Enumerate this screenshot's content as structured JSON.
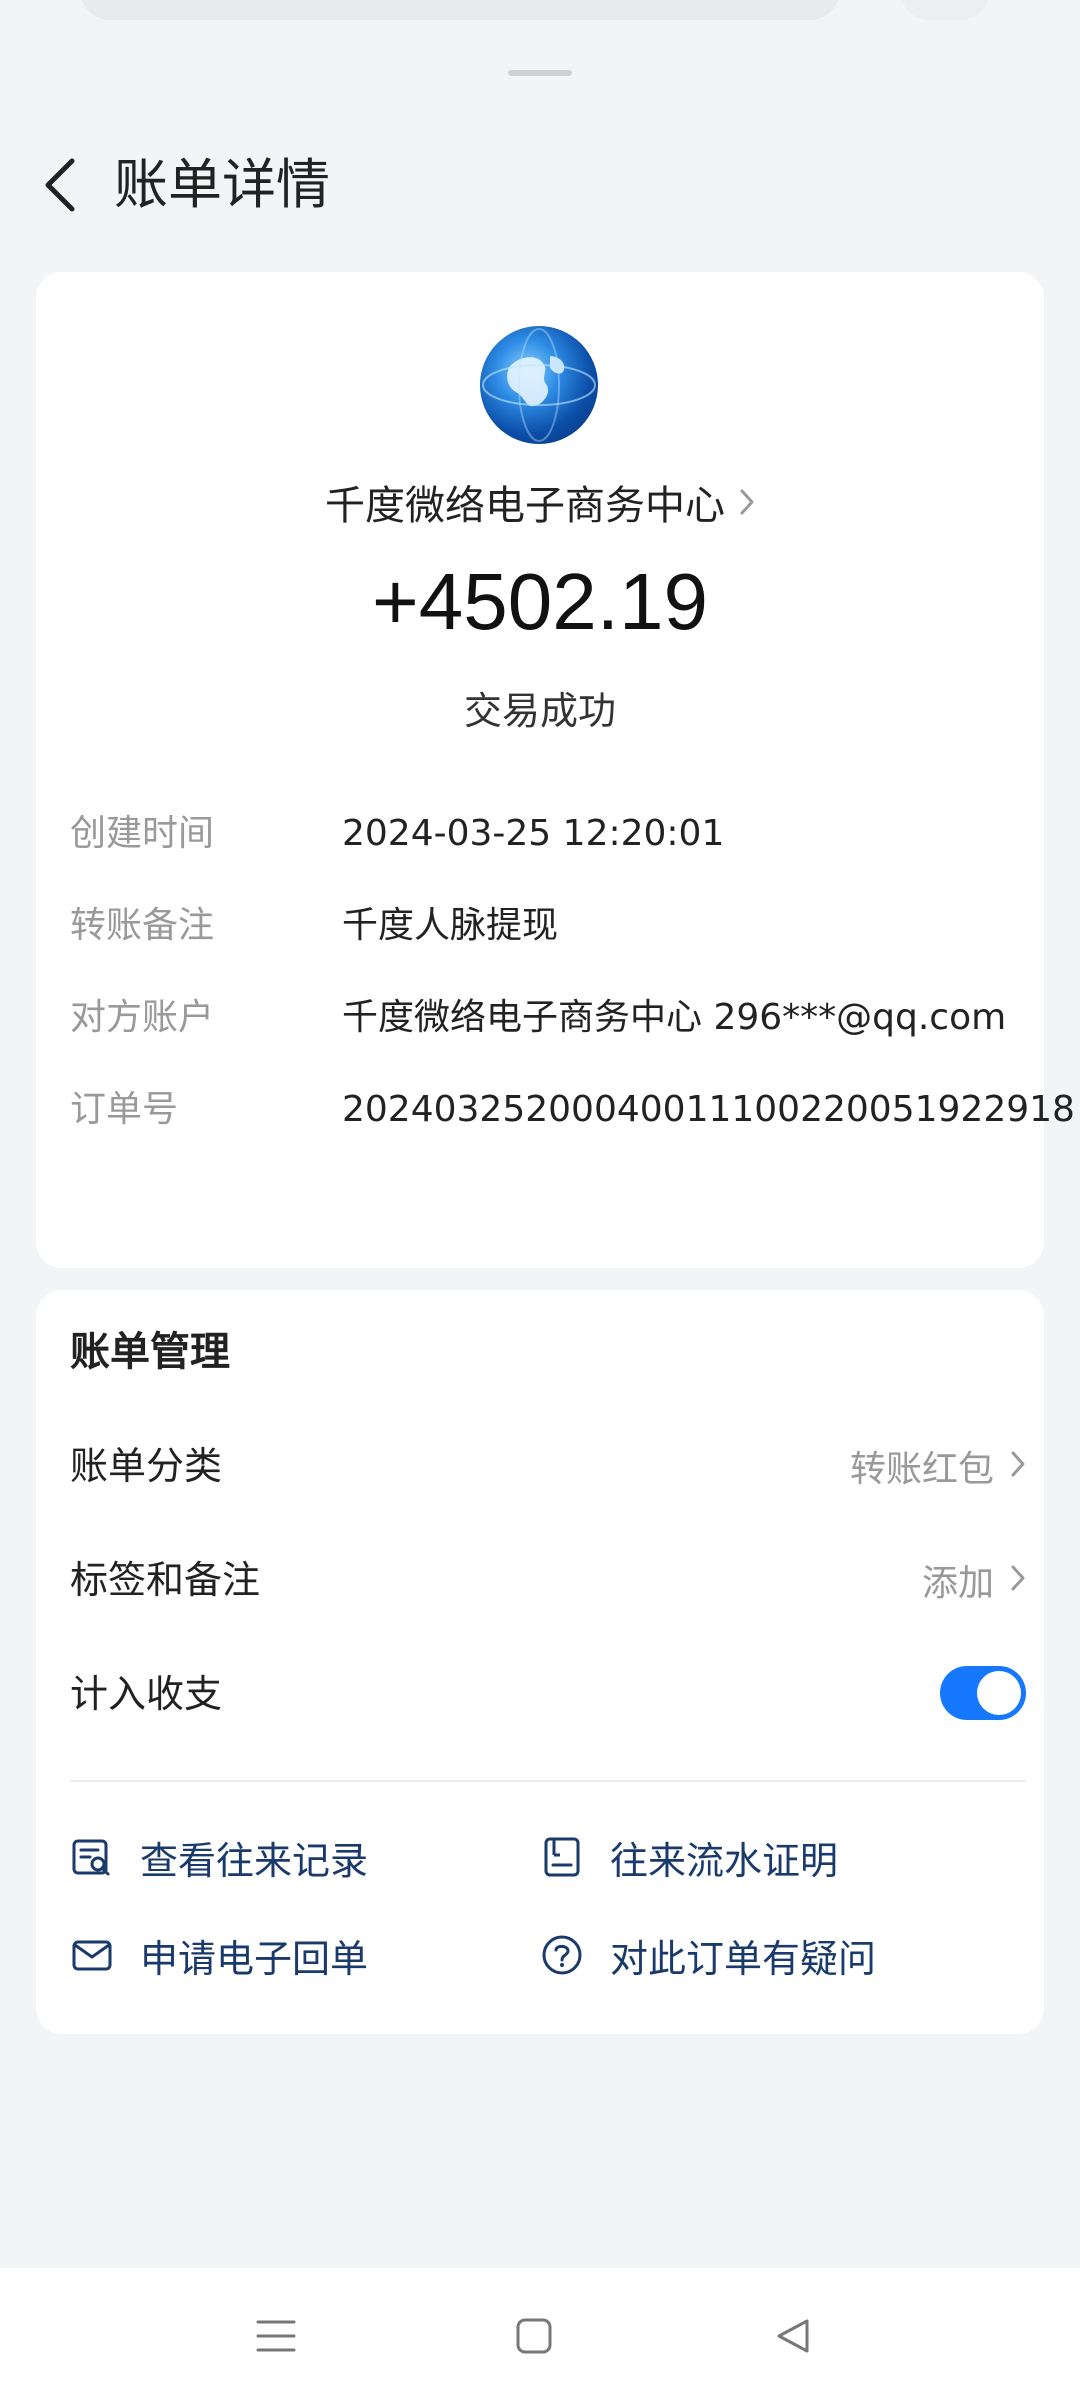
{
  "header": {
    "title": "账单详情"
  },
  "transaction": {
    "merchant": "千度微络电子商务中心",
    "amount": "+4502.19",
    "status": "交易成功"
  },
  "details": [
    {
      "label": "创建时间",
      "value": "2024-03-25 12:20:01"
    },
    {
      "label": "转账备注",
      "value": "千度人脉提现"
    },
    {
      "label": "对方账户",
      "value": "千度微络电子商务中心 296***@qq.com"
    },
    {
      "label": "订单号",
      "value": "20240325200040011100220051922918"
    }
  ],
  "management": {
    "title": "账单管理",
    "category_label": "账单分类",
    "category_value": "转账红包",
    "tags_label": "标签和备注",
    "tags_value": "添加",
    "income_label": "计入收支",
    "income_enabled": true,
    "actions": [
      {
        "label": "查看往来记录",
        "icon": "records-search-icon"
      },
      {
        "label": "往来流水证明",
        "icon": "statement-proof-icon"
      },
      {
        "label": "申请电子回单",
        "icon": "envelope-icon"
      },
      {
        "label": "对此订单有疑问",
        "icon": "question-icon"
      }
    ]
  },
  "colors": {
    "accent": "#1677ff",
    "action_text": "#1a3a6b",
    "background": "#f3f4f6"
  }
}
